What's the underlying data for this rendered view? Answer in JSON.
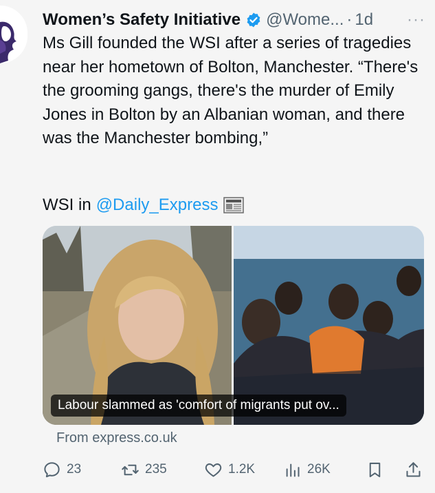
{
  "tweet": {
    "author_name": "Women’s Safety Initiative",
    "handle": "@Wome...",
    "dot": "·",
    "time": "1d",
    "more": "···",
    "text": "Ms Gill founded the WSI after a series of tragedies near her hometown of Bolton, Manchester. “There's the grooming gangs, there's the murder of Emily Jones in Bolton by an Albanian woman, and there was the Manchester bombing,”",
    "source_prefix": "WSI in",
    "source_mention": "@Daily_Express"
  },
  "card": {
    "caption": "Labour slammed as 'comfort of migrants put ov...",
    "from": "From express.co.uk"
  },
  "actions": {
    "replies": "23",
    "reposts": "235",
    "likes": "1.2K",
    "views": "26K"
  },
  "colors": {
    "accent": "#1d9bf0",
    "muted": "#536471",
    "background": "#f5f5f5"
  },
  "icons": [
    "verified-badge-icon",
    "newspaper-icon",
    "reply-icon",
    "repost-icon",
    "like-icon",
    "views-icon",
    "bookmark-icon",
    "share-icon"
  ]
}
